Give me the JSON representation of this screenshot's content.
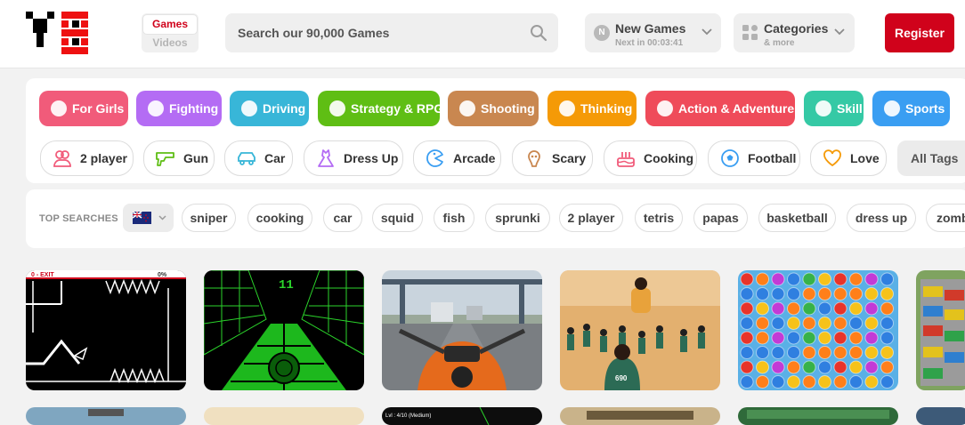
{
  "header": {
    "logo_name": "logo",
    "switch": {
      "active": "Games",
      "inactive": "Videos"
    },
    "search": {
      "placeholder": "Search our 90,000 Games",
      "icon": "search-icon"
    },
    "new_games": {
      "title": "New Games",
      "subtitle": "Next in 00:03:41",
      "badge": "N"
    },
    "categories": {
      "title": "Categories",
      "subtitle": "& more"
    },
    "register_label": "Register"
  },
  "category_pills": [
    {
      "label": "For Girls",
      "color": "#f15b7a",
      "icon": "girl-face-icon"
    },
    {
      "label": "Fighting",
      "color": "#b46cf4",
      "icon": "crossed-swords-icon"
    },
    {
      "label": "Driving",
      "color": "#38b6d8",
      "icon": "checkered-flag-icon"
    },
    {
      "label": "Strategy & RPG",
      "color": "#5fbe14",
      "icon": "chess-piece-icon"
    },
    {
      "label": "Shooting",
      "color": "#c98750",
      "icon": "target-icon"
    },
    {
      "label": "Thinking",
      "color": "#f59a07",
      "icon": "thought-bubble-icon"
    },
    {
      "label": "Action & Adventure",
      "color": "#ef4b5a",
      "icon": "glasses-icon"
    },
    {
      "label": "Skill",
      "color": "#35c9a5",
      "icon": "ninja-icon"
    },
    {
      "label": "Sports",
      "color": "#3a9ef2",
      "icon": "soccer-ball-icon"
    }
  ],
  "tags": [
    {
      "label": "2 player",
      "icon": "two-player-icon",
      "color": "#f15b7a"
    },
    {
      "label": "Gun",
      "icon": "gun-icon",
      "color": "#5fbe14"
    },
    {
      "label": "Car",
      "icon": "car-icon",
      "color": "#38b6d8"
    },
    {
      "label": "Dress Up",
      "icon": "dress-icon",
      "color": "#b46cf4"
    },
    {
      "label": "Arcade",
      "icon": "arcade-icon",
      "color": "#3a9ef2"
    },
    {
      "label": "Scary",
      "icon": "scary-icon",
      "color": "#c98750"
    },
    {
      "label": "Cooking",
      "icon": "cake-icon",
      "color": "#f15b7a"
    },
    {
      "label": "Football",
      "icon": "football-icon",
      "color": "#3a9ef2"
    },
    {
      "label": "Love",
      "icon": "heart-icon",
      "color": "#f59a07"
    }
  ],
  "all_tags_label": "All Tags",
  "top_searches": {
    "label": "TOP SEARCHES",
    "region_flag": "new-zealand-flag-icon",
    "chips": [
      "sniper",
      "cooking",
      "car",
      "squid",
      "fish",
      "sprunki",
      "2 player",
      "tetris",
      "papas",
      "basketball",
      "dress up",
      "zombie"
    ]
  },
  "games": {
    "row1": [
      {
        "name": "geometry-runner-game-thumbnail",
        "hud_left": "0 - EXIT",
        "hud_right": "0%"
      },
      {
        "name": "slope-tunnel-game-thumbnail",
        "counter": "11"
      },
      {
        "name": "moto-highway-game-thumbnail"
      },
      {
        "name": "squid-challenge-game-thumbnail",
        "player_number": "690"
      },
      {
        "name": "jewel-match-game-thumbnail"
      },
      {
        "name": "parking-jam-game-thumbnail"
      }
    ],
    "row2_hud": "Lvl : 4/10 (Medium)"
  }
}
